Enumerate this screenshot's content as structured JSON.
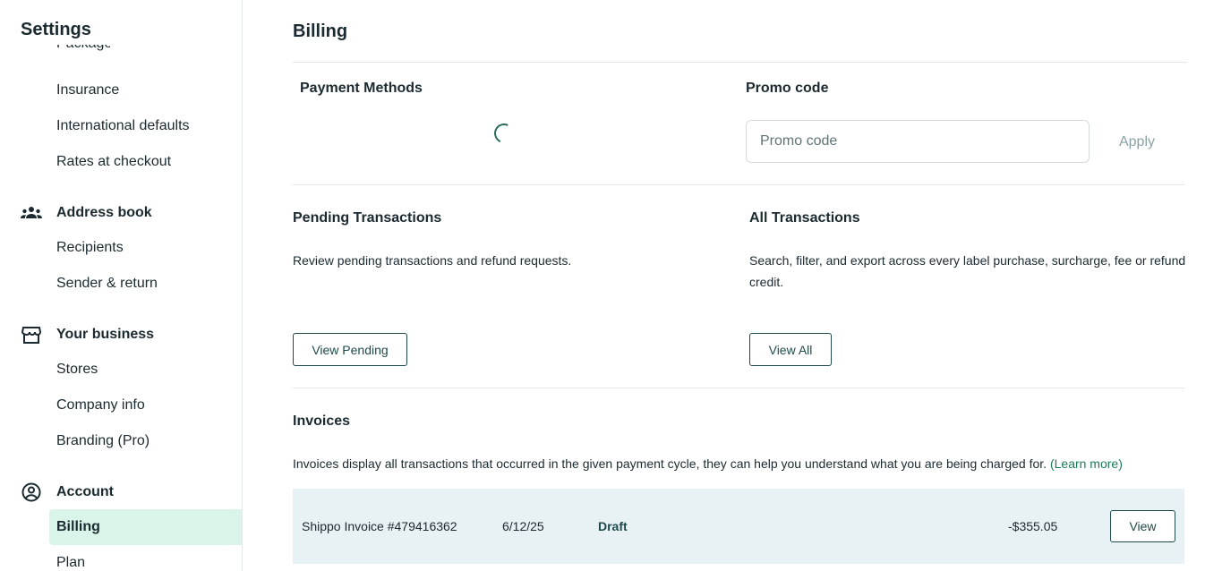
{
  "sidebar": {
    "title": "Settings",
    "partial_item": "Packages",
    "items_top": [
      "Insurance",
      "International defaults",
      "Rates at checkout"
    ],
    "groups": [
      {
        "label": "Address book",
        "icon": "people-icon",
        "items": [
          "Recipients",
          "Sender & return"
        ]
      },
      {
        "label": "Your business",
        "icon": "store-icon",
        "items": [
          "Stores",
          "Company info",
          "Branding (Pro)"
        ]
      },
      {
        "label": "Account",
        "icon": "account-circle-icon",
        "items": [
          "Billing",
          "Plan"
        ]
      }
    ],
    "active_item": "Billing"
  },
  "main": {
    "title": "Billing",
    "payment_methods": {
      "title": "Payment Methods"
    },
    "promo": {
      "title": "Promo code",
      "placeholder": "Promo code",
      "apply_label": "Apply"
    },
    "pending": {
      "title": "Pending Transactions",
      "description": "Review pending transactions and refund requests.",
      "button": "View Pending"
    },
    "all": {
      "title": "All Transactions",
      "description": "Search, filter, and export across every label purchase, surcharge, fee or refund credit.",
      "button": "View All"
    },
    "invoices": {
      "title": "Invoices",
      "description": "Invoices display all transactions that occurred in the given payment cycle, they can help you understand what you are being charged for.",
      "learn_more": "(Learn more)",
      "rows": [
        {
          "name": "Shippo Invoice #479416362",
          "date": "6/12/25",
          "status": "Draft",
          "amount": "-$355.05",
          "action": "View"
        }
      ]
    }
  },
  "colors": {
    "accent": "#1e4a4a",
    "active_bg": "#d9f5e9",
    "link": "#1a7a5b",
    "row_bg": "#e8f1f3"
  }
}
